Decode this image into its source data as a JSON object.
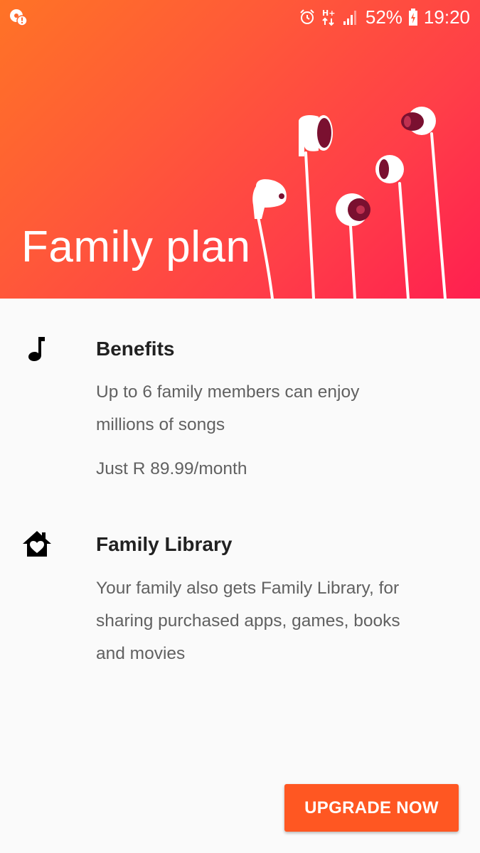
{
  "status_bar": {
    "left_icon": "notification-alert-icon",
    "alarm_icon": "alarm-clock-icon",
    "network_icon": "hplus-data-icon",
    "signal_icon": "signal-bars-icon",
    "battery_percent": "52%",
    "battery_icon": "battery-charging-icon",
    "time": "19:20"
  },
  "hero": {
    "title": "Family plan",
    "gradient_colors": [
      "#ff7326",
      "#ff1f50"
    ],
    "illustration": "earbuds-illustration"
  },
  "benefits": {
    "icon": "music-note-icon",
    "title": "Benefits",
    "description": "Up to 6 family members can enjoy millions of songs",
    "price": "Just R 89.99/month"
  },
  "family_library": {
    "icon": "house-heart-icon",
    "title": "Family Library",
    "description": "Your family also gets Family Library, for sharing purchased apps, games, books and movies"
  },
  "actions": {
    "upgrade_label": "UPGRADE NOW",
    "accent_color": "#ff5722"
  }
}
